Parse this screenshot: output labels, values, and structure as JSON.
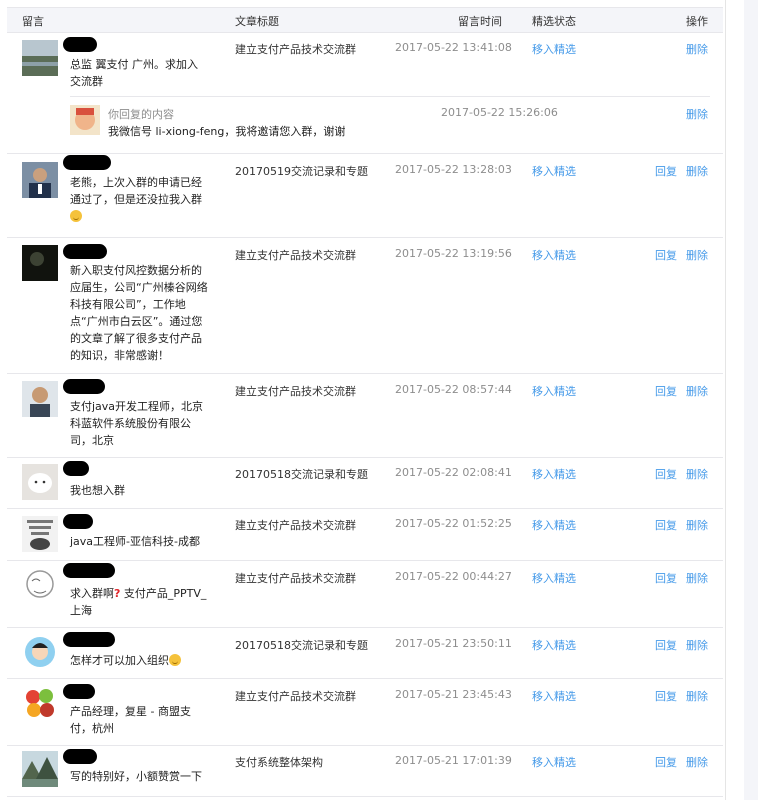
{
  "header": {
    "col_message": "留言",
    "col_title": "文章标题",
    "col_time": "留言时间",
    "col_featured": "精选状态",
    "col_action": "操作"
  },
  "rows": [
    {
      "message": "总监 翼支付 广州。求加入交流群",
      "article": "建立支付产品技术交流群",
      "time": "2017-05-22 13:41:08",
      "featured": "移入精选",
      "delete": "删除",
      "reply_block": {
        "label": "你回复的内容",
        "text": "我微信号 li-xiong-feng，我将邀请您入群，谢谢",
        "time": "2017-05-22 15:26:06",
        "delete": "删除"
      }
    },
    {
      "message": "老熊，上次入群的申请已经通过了，但是还没拉我入群",
      "article": "20170519交流记录和专题",
      "time": "2017-05-22 13:28:03",
      "featured": "移入精选",
      "reply": "回复",
      "delete": "删除"
    },
    {
      "message": "新入职支付风控数据分析的应届生，公司“广州榛谷网络科技有限公司”，工作地点“广州市白云区”。通过您的文章了解了很多支付产品的知识，非常感谢！",
      "article": "建立支付产品技术交流群",
      "time": "2017-05-22 13:19:56",
      "featured": "移入精选",
      "reply": "回复",
      "delete": "删除"
    },
    {
      "message": "支付java开发工程师，北京科蓝软件系统股份有限公司，北京",
      "article": "建立支付产品技术交流群",
      "time": "2017-05-22 08:57:44",
      "featured": "移入精选",
      "reply": "回复",
      "delete": "删除"
    },
    {
      "message": "我也想入群",
      "article": "20170518交流记录和专题",
      "time": "2017-05-22 02:08:41",
      "featured": "移入精选",
      "reply": "回复",
      "delete": "删除"
    },
    {
      "message": "java工程师-亚信科技-成都",
      "article": "建立支付产品技术交流群",
      "time": "2017-05-22 01:52:25",
      "featured": "移入精选",
      "reply": "回复",
      "delete": "删除"
    },
    {
      "message_a": "求入群啊",
      "message_b": "支付产品_PPTV_上海",
      "article": "建立支付产品技术交流群",
      "time": "2017-05-22 00:44:27",
      "featured": "移入精选",
      "reply": "回复",
      "delete": "删除"
    },
    {
      "message": "怎样才可以加入组织",
      "article": "20170518交流记录和专题",
      "time": "2017-05-21 23:50:11",
      "featured": "移入精选",
      "reply": "回复",
      "delete": "删除"
    },
    {
      "message": "产品经理，复星 - 商盟支付，杭州",
      "article": "建立支付产品技术交流群",
      "time": "2017-05-21 23:45:43",
      "featured": "移入精选",
      "reply": "回复",
      "delete": "删除"
    },
    {
      "message": "写的特别好，小额赞赏一下",
      "article": "支付系统整体架构",
      "time": "2017-05-21 17:01:39",
      "featured": "移入精选",
      "reply": "回复",
      "delete": "删除"
    }
  ],
  "icons": {
    "emoji": "smiley-emoji-icon",
    "question": "red-question-mark-icon"
  }
}
